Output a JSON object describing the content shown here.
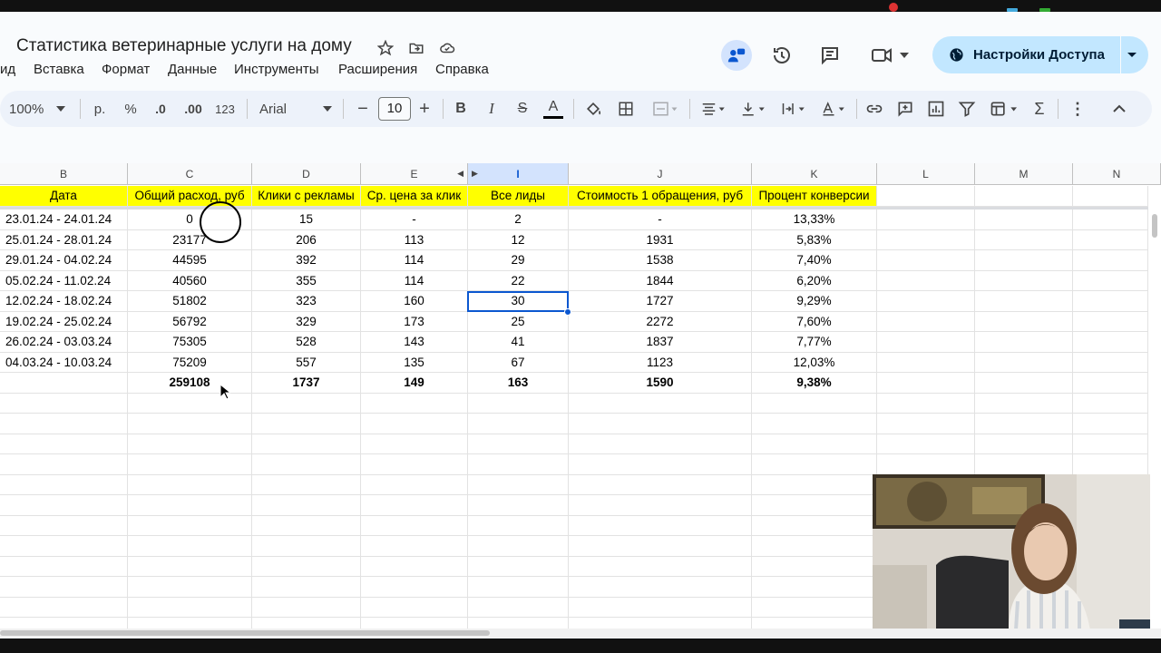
{
  "doc": {
    "title": "Статистика ветеринарные услуги на дому"
  },
  "menu": [
    "ид",
    "Вставка",
    "Формат",
    "Данные",
    "Инструменты",
    "Расширения",
    "Справка"
  ],
  "share": {
    "label": "Настройки Доступа"
  },
  "toolbar": {
    "zoom": "100%",
    "currency": "р.",
    "percent": "%",
    "dec_less": ".0",
    "dec_more": ".00",
    "format_123": "123",
    "font": "Arial",
    "font_size": "10",
    "bold": "B",
    "italic": "I",
    "strike": "S",
    "text_color": "A"
  },
  "columns": [
    "B",
    "C",
    "D",
    "E",
    "I",
    "J",
    "K",
    "L",
    "M",
    "N"
  ],
  "headers": [
    "Дата",
    "Общий расход, руб",
    "Клики с рекламы",
    "Ср. цена за клик",
    "Все лиды",
    "Стоимость 1 обращения, руб",
    "Процент конверсии"
  ],
  "rows": [
    [
      "23.01.24 - 24.01.24",
      "0",
      "15",
      "-",
      "2",
      "-",
      "13,33%"
    ],
    [
      "25.01.24 - 28.01.24",
      "23177",
      "206",
      "113",
      "12",
      "1931",
      "5,83%"
    ],
    [
      "29.01.24 - 04.02.24",
      "44595",
      "392",
      "114",
      "29",
      "1538",
      "7,40%"
    ],
    [
      "05.02.24 - 11.02.24",
      "40560",
      "355",
      "114",
      "22",
      "1844",
      "6,20%"
    ],
    [
      "12.02.24 - 18.02.24",
      "51802",
      "323",
      "160",
      "30",
      "1727",
      "9,29%"
    ],
    [
      "19.02.24 - 25.02.24",
      "56792",
      "329",
      "173",
      "25",
      "2272",
      "7,60%"
    ],
    [
      "26.02.24 - 03.03.24",
      "75305",
      "528",
      "143",
      "41",
      "1837",
      "7,77%"
    ],
    [
      "04.03.24 - 10.03.24",
      "75209",
      "557",
      "135",
      "67",
      "1123",
      "12,03%"
    ]
  ],
  "totals": [
    "",
    "259108",
    "1737",
    "149",
    "163",
    "1590",
    "9,38%"
  ]
}
